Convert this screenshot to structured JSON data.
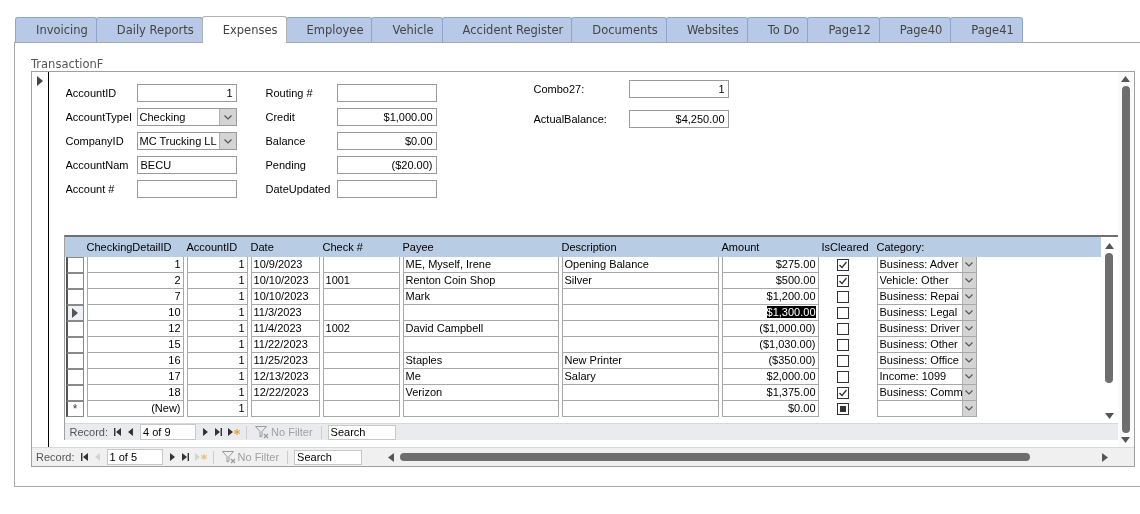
{
  "tabs": [
    {
      "label": "Invoicing",
      "selected": false
    },
    {
      "label": "Daily Reports",
      "selected": false
    },
    {
      "label": "Expenses",
      "selected": true
    },
    {
      "label": "Employee",
      "selected": false
    },
    {
      "label": "Vehicle",
      "selected": false
    },
    {
      "label": "Accident Register",
      "selected": false
    },
    {
      "label": "Documents",
      "selected": false
    },
    {
      "label": "Websites",
      "selected": false
    },
    {
      "label": "To Do",
      "selected": false
    },
    {
      "label": "Page12",
      "selected": false
    },
    {
      "label": "Page40",
      "selected": false
    },
    {
      "label": "Page41",
      "selected": false
    }
  ],
  "form_title": "TransactionF",
  "fields_left": [
    {
      "label": "AccountID",
      "value": "1",
      "kind": "number"
    },
    {
      "label": "AccountTypeI",
      "value": "Checking",
      "kind": "combo"
    },
    {
      "label": "CompanyID",
      "value": "MC Trucking LL",
      "kind": "combo"
    },
    {
      "label": "AccountNam",
      "value": "BECU",
      "kind": "text"
    },
    {
      "label": "Account #",
      "kind": "text"
    }
  ],
  "fields_middle": [
    {
      "label": "Routing #",
      "kind": "text"
    },
    {
      "label": "Credit",
      "value": "$1,000.00",
      "kind": "number"
    },
    {
      "label": "Balance",
      "value": "$0.00",
      "kind": "number"
    },
    {
      "label": "Pending",
      "value": "($20.00)",
      "kind": "number"
    },
    {
      "label": "DateUpdated",
      "kind": "text"
    }
  ],
  "fields_right": [
    {
      "label": "Combo27:",
      "value": "1",
      "kind": "number"
    },
    {
      "label": "ActualBalance:",
      "value": "$4,250.00",
      "kind": "number"
    }
  ],
  "datasheet": {
    "columns": [
      "CheckingDetailID",
      "AccountID",
      "Date",
      "Check #",
      "Payee",
      "Description",
      "Amount",
      "IsCleared",
      "Category:"
    ],
    "rows": [
      {
        "id": "1",
        "account": "1",
        "date": "10/9/2023",
        "payee": "ME, Myself, Irene",
        "description": "Opening Balance",
        "amount": "$275.00",
        "checked": true,
        "category": "Business: Adver",
        "selected": false
      },
      {
        "id": "2",
        "account": "1",
        "date": "10/10/2023",
        "check": "1001",
        "payee": "Renton Coin Shop",
        "description": "Silver",
        "amount": "$500.00",
        "checked": true,
        "category": "Vehicle: Other",
        "selected": false
      },
      {
        "id": "7",
        "account": "1",
        "date": "10/10/2023",
        "payee": "Mark",
        "amount": "$1,200.00",
        "checked": false,
        "category": "Business: Repai",
        "selected": false
      },
      {
        "id": "10",
        "account": "1",
        "date": "11/3/2023",
        "amount": "$1,300.00",
        "checked": false,
        "category": "Business: Legal",
        "selected": true
      },
      {
        "id": "12",
        "account": "1",
        "date": "11/4/2023",
        "check": "1002",
        "payee": "David Campbell",
        "amount": "($1,000.00)",
        "checked": false,
        "category": "Business: Driver",
        "selected": false
      },
      {
        "id": "15",
        "account": "1",
        "date": "11/22/2023",
        "amount": "($1,030.00)",
        "checked": false,
        "category": "Business: Other",
        "selected": false
      },
      {
        "id": "16",
        "account": "1",
        "date": "11/25/2023",
        "payee": "Staples",
        "description": "New Printer",
        "amount": "($350.00)",
        "checked": false,
        "category": "Business: Office",
        "selected": false
      },
      {
        "id": "17",
        "account": "1",
        "date": "12/13/2023",
        "payee": "Me",
        "description": "Salary",
        "amount": "$2,000.00",
        "checked": false,
        "category": "Income: 1099",
        "selected": false
      },
      {
        "id": "18",
        "account": "1",
        "date": "12/22/2023",
        "payee": "Verizon",
        "amount": "$1,375.00",
        "checked": true,
        "category": "Business: Comm",
        "selected": false
      },
      {
        "kind": "new",
        "selector": "*",
        "id": "(New)",
        "account": "1",
        "amount": "$0.00",
        "indeterminate": true,
        "selected": false
      }
    ],
    "nav": {
      "label": "Record:",
      "position": "4 of 9",
      "filter": "No Filter",
      "search_placeholder": "Search",
      "buttons": [
        {
          "kind": "first",
          "disabled": false
        },
        {
          "kind": "prev",
          "disabled": false
        },
        {
          "kind": "next",
          "disabled": false
        },
        {
          "kind": "last",
          "disabled": false
        },
        {
          "kind": "new",
          "disabled": false
        }
      ]
    }
  },
  "nav": {
    "label": "Record:",
    "position": "1 of 5",
    "filter": "No Filter",
    "search_placeholder": "Search",
    "buttons": [
      {
        "kind": "first",
        "disabled": false
      },
      {
        "kind": "prev",
        "disabled": true
      },
      {
        "kind": "next",
        "disabled": false
      },
      {
        "kind": "last",
        "disabled": false
      },
      {
        "kind": "new",
        "disabled": true
      }
    ]
  }
}
